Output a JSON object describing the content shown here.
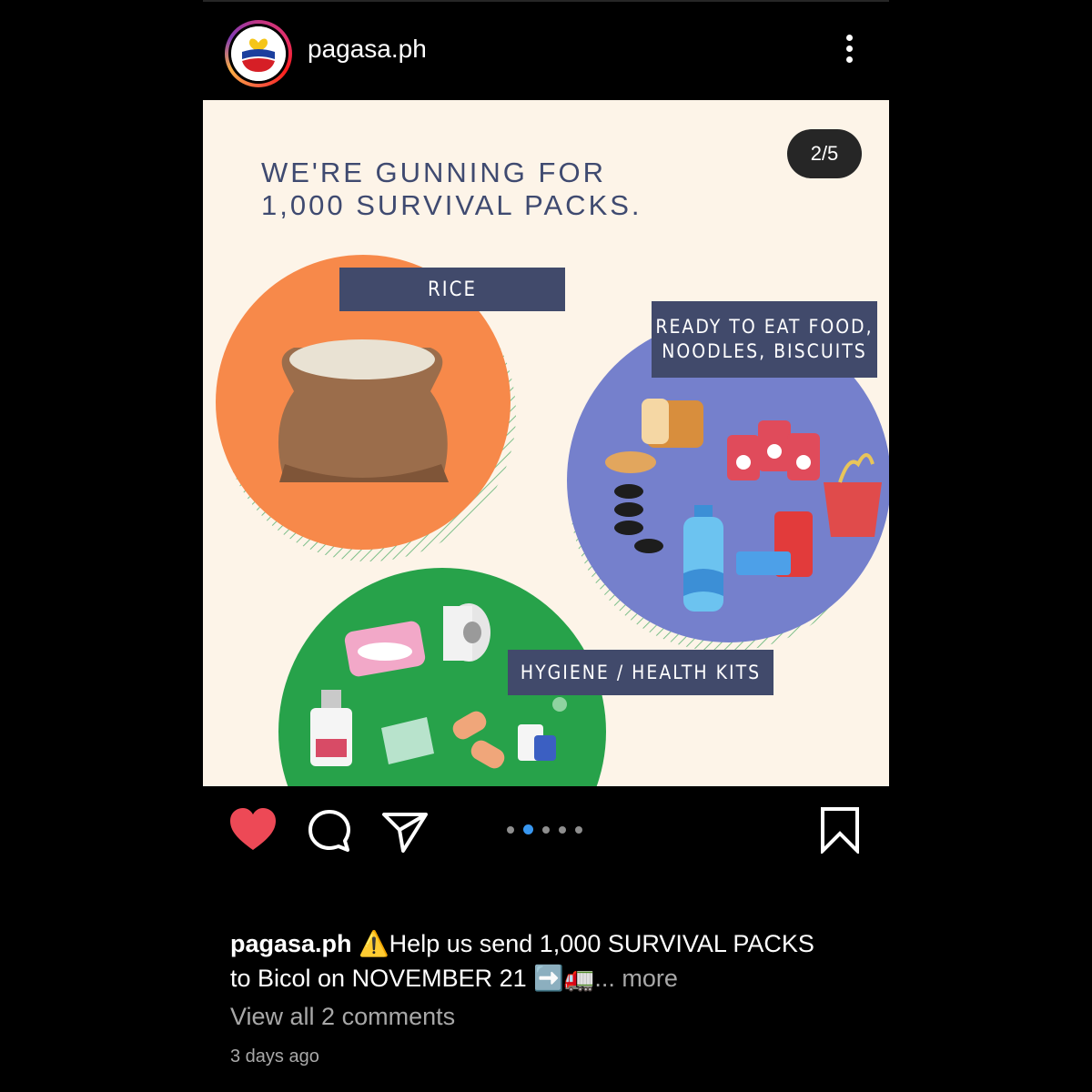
{
  "header": {
    "username": "pagasa.ph",
    "more_icon": "more-vertical-icon"
  },
  "post": {
    "counter": "2/5",
    "headline_line1": "WE'RE GUNNING FOR",
    "headline_line2": "1,000 SURVIVAL PACKS.",
    "labels": {
      "rice": "RICE",
      "food_line1": "READY TO EAT FOOD,",
      "food_line2": "NOODLES, BISCUITS",
      "hygiene": "HYGIENE / HEALTH KITS"
    },
    "colors": {
      "rice_circle": "#f7894a",
      "food_circle": "#7580cc",
      "hygiene_circle": "#27a24a",
      "label_bg": "#414a6b",
      "background": "#fdf4e8"
    }
  },
  "actions": {
    "like_icon": "heart-filled-icon",
    "comment_icon": "comment-icon",
    "share_icon": "send-icon",
    "save_icon": "bookmark-icon",
    "like_color": "#ed4956"
  },
  "carousel": {
    "count": 5,
    "active_index": 1
  },
  "caption": {
    "username": "pagasa.ph",
    "text_line1": "⚠️Help us send 1,000 SURVIVAL PACKS",
    "text_line2": "to Bicol on NOVEMBER 21 ➡️🚛",
    "more": "... more"
  },
  "comments": {
    "link": "View all 2 comments"
  },
  "timestamp": "3 days ago"
}
